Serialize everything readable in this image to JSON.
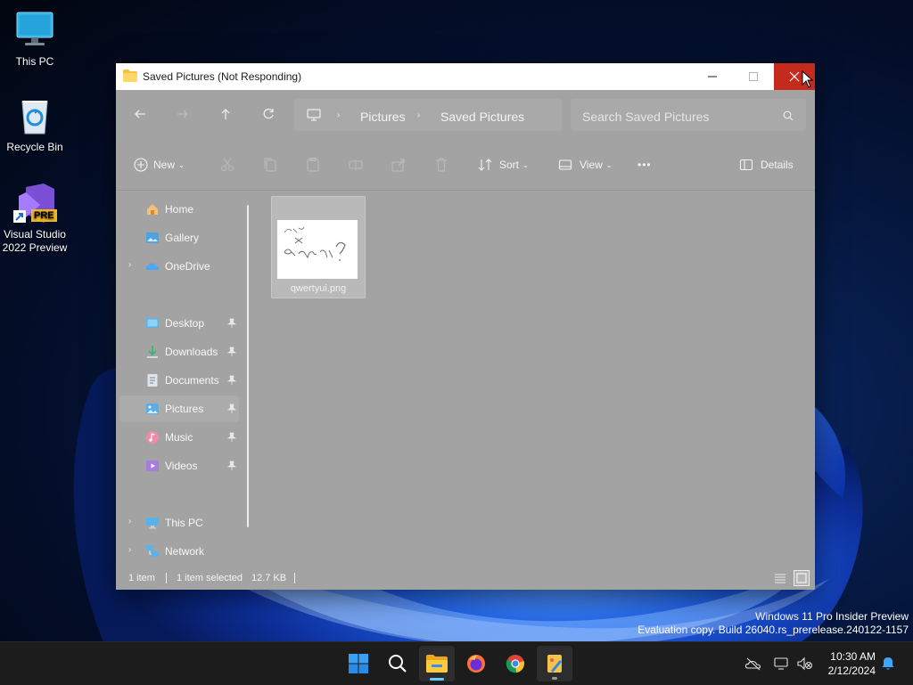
{
  "desktop": {
    "icons": [
      {
        "label": "This PC"
      },
      {
        "label": "Recycle Bin"
      },
      {
        "label": "Visual Studio 2022 Preview",
        "badge": "PRE"
      }
    ],
    "watermark": {
      "line1": "Windows 11 Pro Insider Preview",
      "line2": "Evaluation copy. Build 26040.rs_prerelease.240122-1157"
    }
  },
  "window": {
    "title": "Saved Pictures (Not Responding)",
    "breadcrumb": [
      "Pictures",
      "Saved Pictures"
    ],
    "search_placeholder": "Search Saved Pictures",
    "commands": {
      "new": "New",
      "sort": "Sort",
      "view": "View",
      "more": "•••",
      "details": "Details"
    },
    "nav": {
      "home": "Home",
      "gallery": "Gallery",
      "onedrive": "OneDrive",
      "desktop": "Desktop",
      "downloads": "Downloads",
      "documents": "Documents",
      "pictures": "Pictures",
      "music": "Music",
      "videos": "Videos",
      "thispc": "This PC",
      "network": "Network"
    },
    "files": [
      {
        "name": "qwertyui.png"
      }
    ],
    "status": {
      "count": "1 item",
      "selected": "1 item selected",
      "size": "12.7 KB"
    }
  },
  "taskbar": {
    "apps": [
      "start-icon",
      "search-icon",
      "file-explorer-icon",
      "firefox-icon",
      "chrome-icon",
      "paint-icon"
    ],
    "clock": {
      "time": "10:30 AM",
      "date": "2/12/2024"
    }
  },
  "colors": {
    "close_red": "#c42b1c",
    "accent_blue": "#60cdff",
    "window_dimmed": "#a3a3a3"
  }
}
